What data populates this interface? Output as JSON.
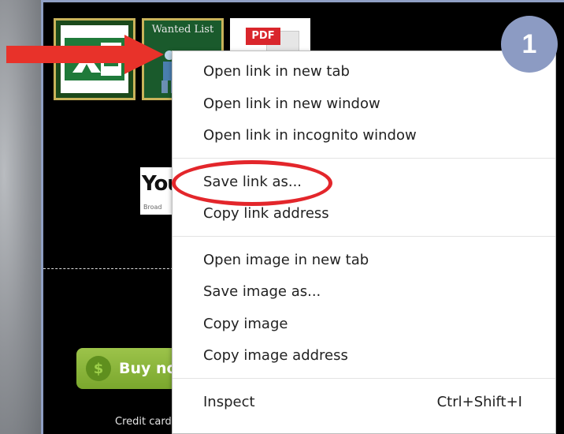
{
  "tiles": {
    "wanted_title": "Wanted List",
    "pdf_label": "PDF",
    "youtube_text": "You",
    "youtube_sub": "Broad"
  },
  "buy_button": {
    "label": "Buy no"
  },
  "credit_text": "Credit card and Paypal",
  "step_badge": "1",
  "context_menu": {
    "items": [
      {
        "label": "Open link in new tab"
      },
      {
        "label": "Open link in new window"
      },
      {
        "label": "Open link in incognito window"
      },
      {
        "label": "Save link as..."
      },
      {
        "label": "Copy link address"
      },
      {
        "label": "Open image in new tab"
      },
      {
        "label": "Save image as..."
      },
      {
        "label": "Copy image"
      },
      {
        "label": "Copy image address"
      },
      {
        "label": "Inspect",
        "shortcut": "Ctrl+Shift+I"
      }
    ]
  },
  "colors": {
    "highlight_ellipse": "#e3262b",
    "arrow": "#e8322a",
    "badge": "#8c9bc3",
    "buy_green": "#8ab83b"
  }
}
